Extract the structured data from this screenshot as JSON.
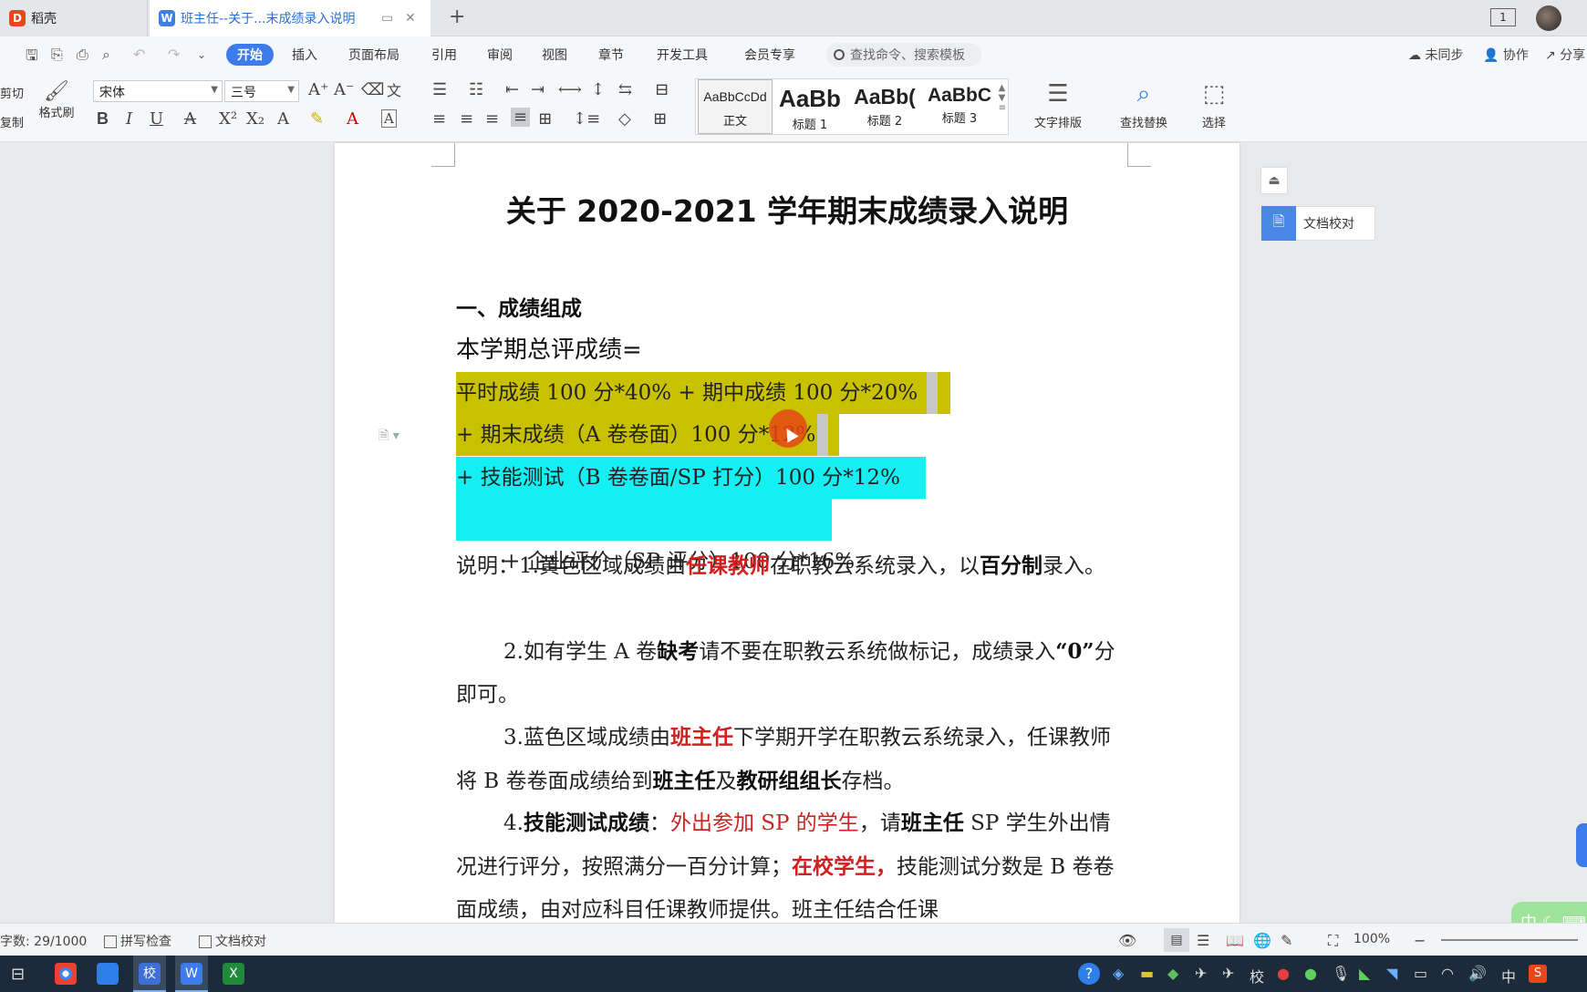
{
  "tabs": {
    "home_label": "稻壳",
    "doc_label": "班主任--关于...末成绩录入说明"
  },
  "window": {
    "count": "1"
  },
  "menu": {
    "items": [
      "开始",
      "插入",
      "页面布局",
      "引用",
      "审阅",
      "视图",
      "章节",
      "开发工具",
      "会员专享"
    ],
    "search_placeholder": "查找命令、搜索模板",
    "sync": "未同步",
    "collab": "协作",
    "share": "分享"
  },
  "ribbon": {
    "cut": "剪切",
    "copy": "复制",
    "format_painter": "格式刷",
    "font_name": "宋体",
    "font_size": "三号",
    "styles": [
      {
        "sample": "AaBbCcDd",
        "caption": "正文"
      },
      {
        "sample": "AaBb",
        "caption": "标题 1"
      },
      {
        "sample": "AaBb(",
        "caption": "标题 2"
      },
      {
        "sample": "AaBbC",
        "caption": "标题 3"
      }
    ],
    "text_layout": "文字排版",
    "find_replace": "查找替换",
    "select": "选择"
  },
  "document": {
    "title": "关于 2020-2021 学年期末成绩录入说明",
    "section1": "一、成绩组成",
    "formula_lead": "本学期总评成绩=",
    "formula_lines": [
      "平时成绩 100 分*40% + 期中成绩 100 分*20%",
      "+ 期末成绩（A 卷卷面）100 分*12%",
      "+ 技能测试（B 卷卷面/SP 打分）100 分*12%",
      " + 企业评价（SP 评分）100 分*16%"
    ],
    "note1": {
      "a": "说明：1.黄色区域成绩由",
      "b": "任课教师",
      "c": "在职教云系统录入，以",
      "d": "百分制",
      "e": "录入。"
    },
    "note2": {
      "a": "2.如有学生 A 卷",
      "b": "缺考",
      "c": "请不要在职教云系统做标记，成绩录入",
      "d": "“0”",
      "e": "分即可。"
    },
    "note3": {
      "a": "3.蓝色区域成绩由",
      "b": "班主任",
      "c": "下学期开学在职教云系统录入，任课教师将 B 卷卷面成绩给到",
      "d": "班主任",
      "e": "及",
      "f": "教研组组长",
      "g": "存档。"
    },
    "note4": {
      "a": "4.",
      "b": "技能测试成绩",
      "c": "：",
      "d": "外出参加 SP 的学生",
      "e": "，请",
      "f": "班主任",
      "g": " SP 学生外出情况进行评分，按照满分一百分计算；",
      "h": "在校学生，",
      "i": "技能测试分数是 B 卷卷面成绩，由对应科目任课教师提供。班主任结合任课"
    }
  },
  "side_panel": {
    "check_label": "文档校对"
  },
  "status": {
    "word_count": "字数: 29/1000",
    "spell_check": "拼写检查",
    "doc_check": "文档校对",
    "zoom": "100%"
  },
  "ime": {
    "label": "中"
  },
  "colors": {
    "accent": "#3b7bea",
    "yellow_highlight": "#c9c000",
    "cyan_highlight": "#14f0f2",
    "red_text": "#d02020"
  }
}
